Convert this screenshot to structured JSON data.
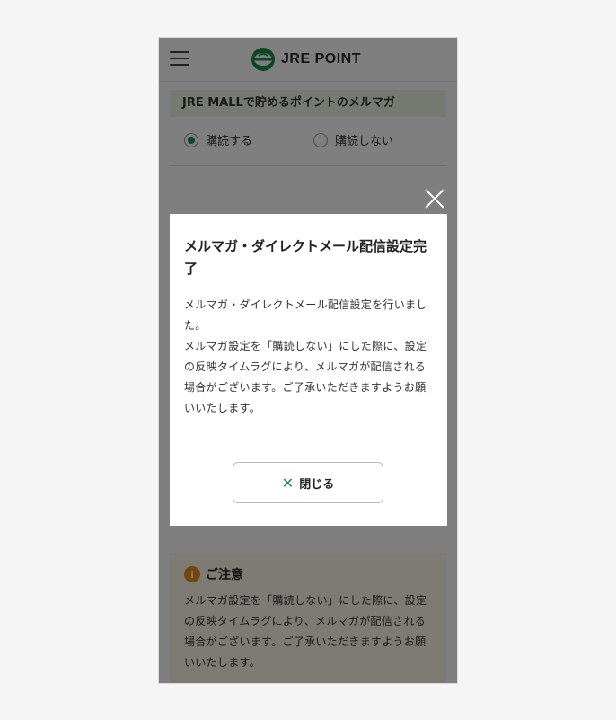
{
  "header": {
    "logo_text": "JRE POINT",
    "brand_color": "#1a8a4a"
  },
  "newsletter": {
    "section_title": "JRE MALLで貯めるポイントのメルマガ",
    "options": [
      {
        "label": "購読する",
        "selected": true
      },
      {
        "label": "購読しない",
        "selected": false
      }
    ]
  },
  "notice": {
    "title": "ご注意",
    "body": "メルマガ設定を「購読しない」にした際に、設定の反映タイムラグにより、メルマガが配信される場合がございます。ご了承いただきますようお願いいたします。"
  },
  "modal": {
    "title": "メルマガ・ダイレクトメール配信設定完了",
    "body_line1": "メルマガ・ダイレクトメール配信設定を行いました。",
    "body_line2": "メルマガ設定を「購読しない」にした際に、設定の反映タイムラグにより、メルマガが配信される場合がございます。ご了承いただきますようお願いいたします。",
    "close_label": "閉じる"
  },
  "icons": {
    "menu": "hamburger-menu-icon",
    "close": "close-icon",
    "info": "info-icon"
  }
}
